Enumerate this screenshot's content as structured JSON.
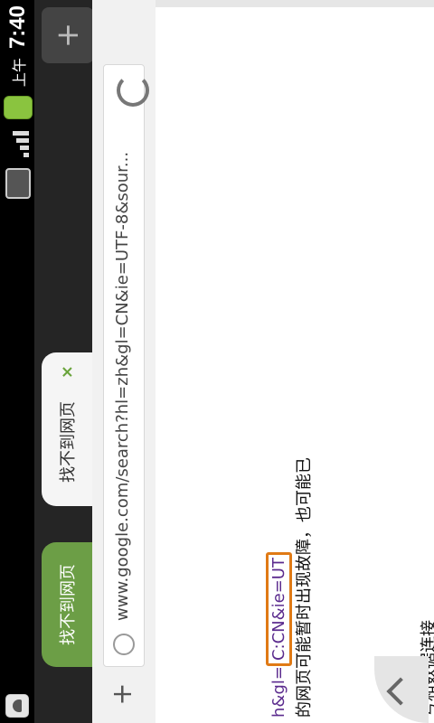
{
  "status": {
    "time": "7:40",
    "ampm": "上午"
  },
  "tabs": [
    {
      "label": "找不到网页"
    },
    {
      "label": "找不到网页"
    }
  ],
  "tabs_close_glyph": "×",
  "newtab_glyph": "+",
  "url": {
    "text": "www.google.com/search?hl=zh&gl=CN&ie=UTF-8&sour..."
  },
  "page": {
    "link_prefix": "h&gl=",
    "link_highlight": "C:CN&ie=UT",
    "body1": "的网页可能暂时出现故障，也可能已",
    "body2": "号和数据连接"
  }
}
